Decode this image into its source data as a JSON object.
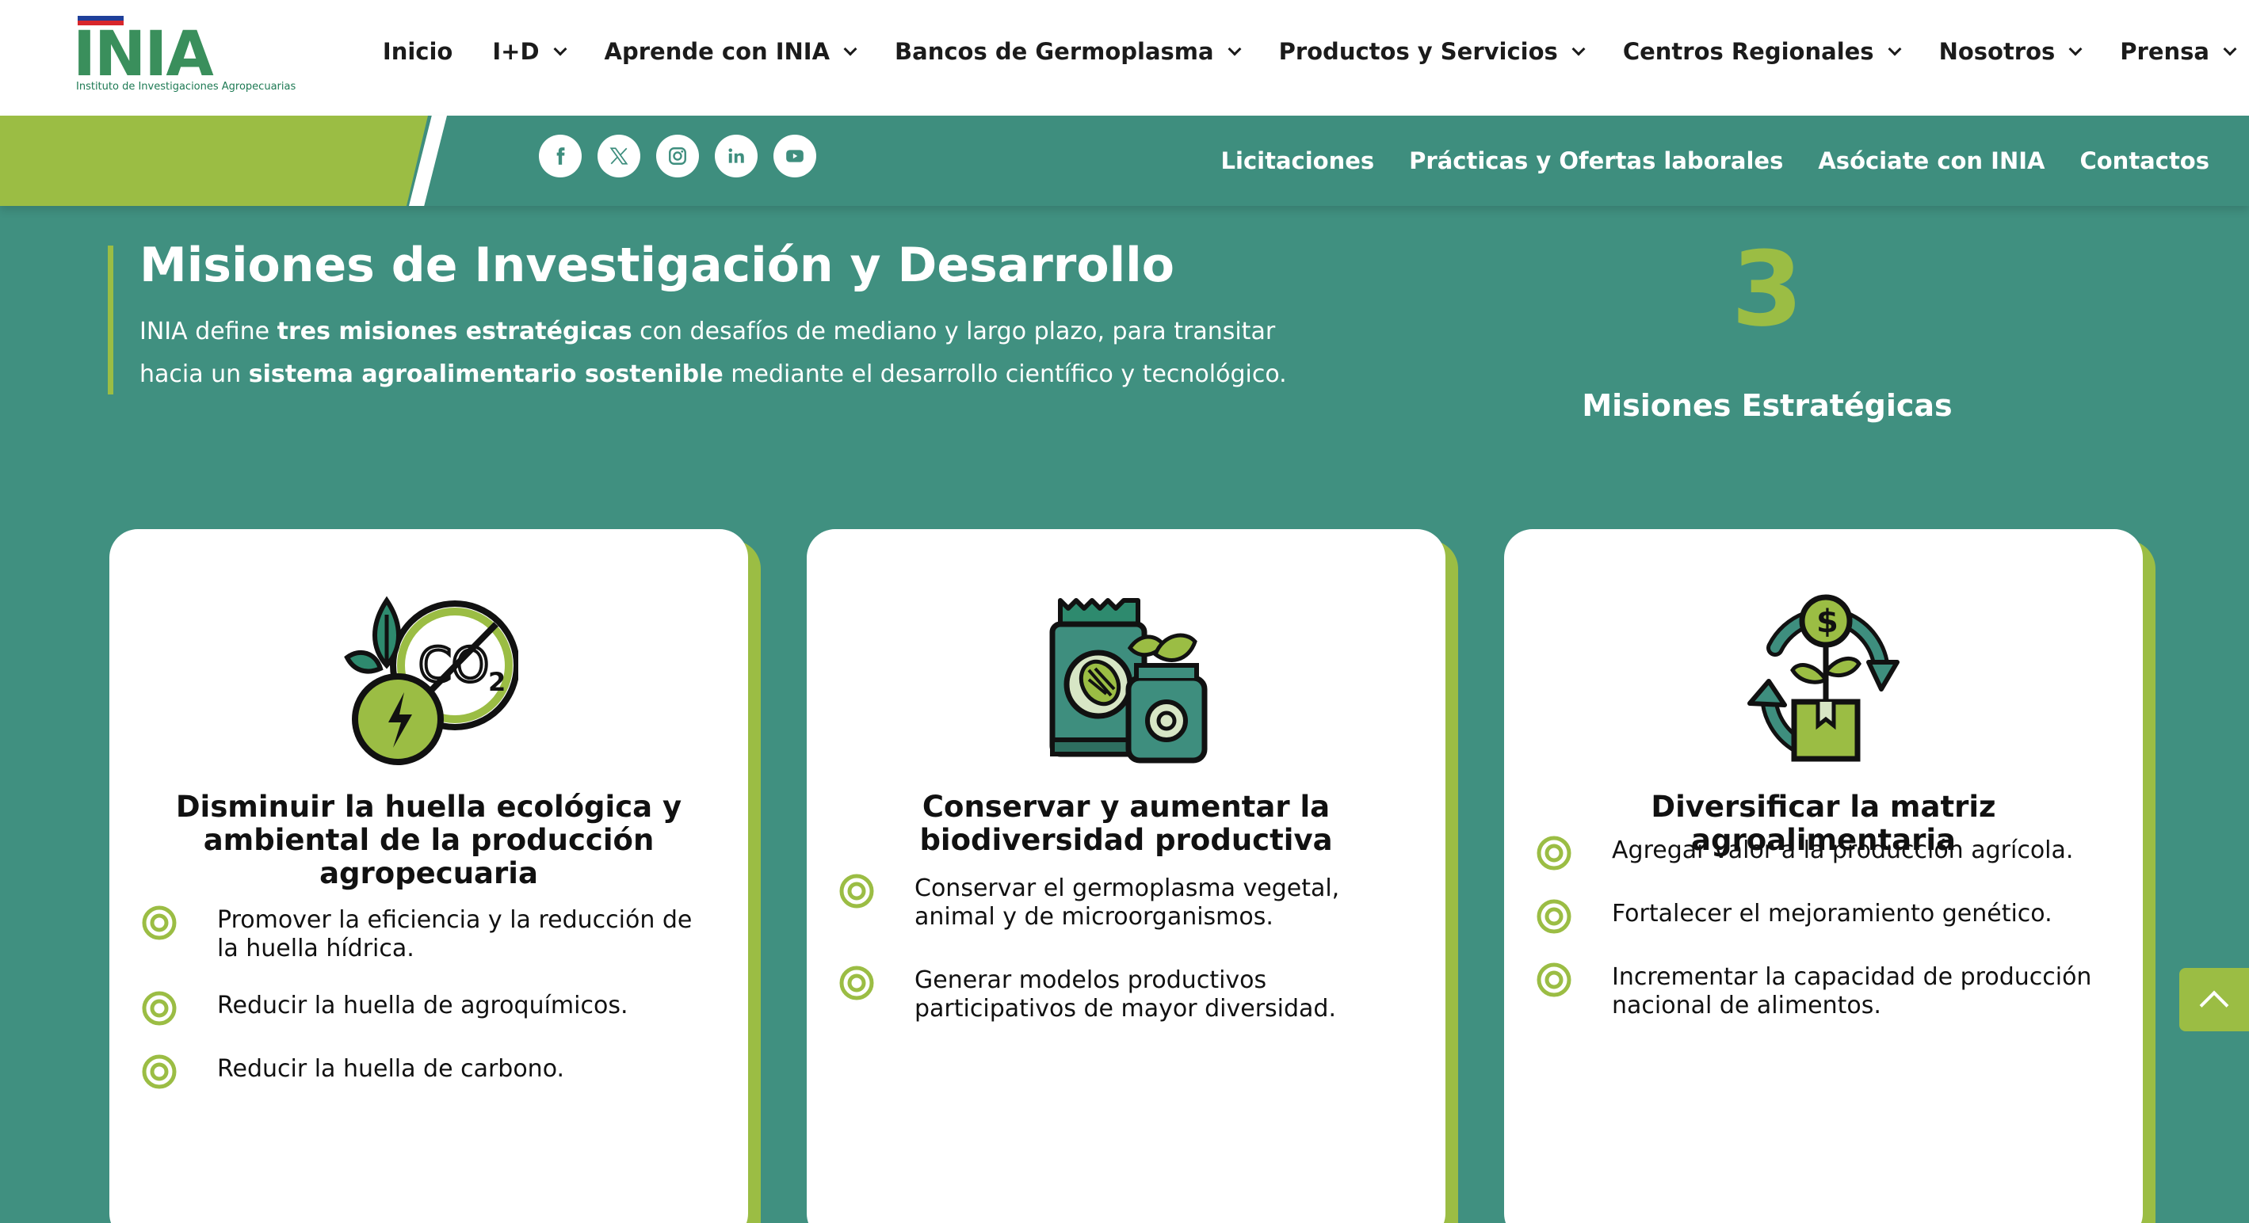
{
  "header": {
    "logo_text": "INIA",
    "logo_subtitle": "Instituto de Investigaciones Agropecuarias",
    "nav": [
      {
        "label": "Inicio",
        "dropdown": false
      },
      {
        "label": "I+D",
        "dropdown": true
      },
      {
        "label": "Aprende con INIA",
        "dropdown": true
      },
      {
        "label": "Bancos de Germoplasma",
        "dropdown": true
      },
      {
        "label": "Productos y Servicios",
        "dropdown": true
      },
      {
        "label": "Centros Regionales",
        "dropdown": true
      },
      {
        "label": "Nosotros",
        "dropdown": true
      },
      {
        "label": "Prensa",
        "dropdown": true
      }
    ]
  },
  "subbar": {
    "social_icons": [
      "facebook-icon",
      "x-twitter-icon",
      "instagram-icon",
      "linkedin-icon",
      "youtube-icon"
    ],
    "links": [
      "Licitaciones",
      "Prácticas y Ofertas laborales",
      "Asóciate con INIA",
      "Contactos"
    ]
  },
  "hero": {
    "title": "Misiones de Investigación y Desarrollo",
    "text_1": "INIA define ",
    "text_bold_1": "tres misiones estratégicas",
    "text_2": " con desafíos de mediano y largo plazo, para transitar hacia un ",
    "text_bold_2": "sistema agroalimentario sostenible",
    "text_3": " mediante el desarrollo científico y tecnológico.",
    "stat_number": "3",
    "stat_label": "Misiones Estratégicas"
  },
  "cards": [
    {
      "icon": "co2-reduction-icon",
      "title": "Disminuir la huella ecológica y ambiental de la producción agropecuaria",
      "bullets": [
        "Promover la eficiencia y la reducción de la huella hídrica.",
        "Reducir la huella de agroquímicos.",
        "Reducir la huella de carbono."
      ]
    },
    {
      "icon": "seed-bag-icon",
      "title": "Conservar y aumentar la biodiversidad productiva",
      "bullets": [
        "Conservar el germoplasma vegetal, animal y de microorganismos.",
        "Generar modelos productivos participativos de mayor diversidad."
      ]
    },
    {
      "icon": "money-plant-cycle-icon",
      "title": "Diversificar la matriz agroalimentaria",
      "bullets": [
        "Agregar valor a la producción agrícola.",
        "Fortalecer el mejoramiento genético.",
        "Incrementar la capacidad de producción nacional de alimentos."
      ]
    }
  ],
  "colors": {
    "teal": "#409080",
    "lime": "#9bbd44",
    "white": "#ffffff",
    "text": "#111111"
  }
}
